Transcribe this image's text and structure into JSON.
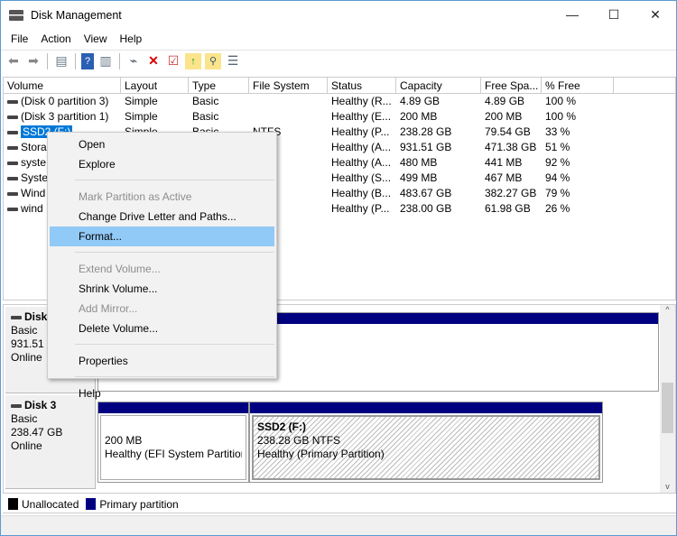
{
  "window": {
    "title": "Disk Management",
    "minimize": "—",
    "maximize": "☐",
    "close": "✕"
  },
  "menu": [
    "File",
    "Action",
    "View",
    "Help"
  ],
  "toolbar": [
    "back-icon",
    "forward-icon",
    "console-tree-icon",
    "help-icon",
    "show-pane-icon",
    "connect-disk-icon",
    "delete-icon",
    "check-icon",
    "folder-up-icon",
    "folder-search-icon",
    "properties-list-icon"
  ],
  "columns": [
    "Volume",
    "Layout",
    "Type",
    "File System",
    "Status",
    "Capacity",
    "Free Spa...",
    "% Free"
  ],
  "rows": [
    [
      "(Disk 0 partition 3)",
      "Simple",
      "Basic",
      "",
      "Healthy (R...",
      "4.89 GB",
      "4.89 GB",
      "100 %"
    ],
    [
      "(Disk 3 partition 1)",
      "Simple",
      "Basic",
      "",
      "Healthy (E...",
      "200 MB",
      "200 MB",
      "100 %"
    ],
    [
      "SSD2 (F:)",
      "Simple",
      "Basic",
      "NTFS",
      "Healthy (P...",
      "238.28 GB",
      "79.54 GB",
      "33 %"
    ],
    [
      "Stora",
      "",
      "",
      "",
      "Healthy (A...",
      "931.51 GB",
      "471.38 GB",
      "51 %"
    ],
    [
      "syste",
      "",
      "",
      "",
      "Healthy (A...",
      "480 MB",
      "441 MB",
      "92 %"
    ],
    [
      "Syste",
      "",
      "",
      "",
      "Healthy (S...",
      "499 MB",
      "467 MB",
      "94 %"
    ],
    [
      "Wind",
      "",
      "",
      "",
      "Healthy (B...",
      "483.67 GB",
      "382.27 GB",
      "79 %"
    ],
    [
      "wind",
      "",
      "",
      "",
      "Healthy (P...",
      "238.00 GB",
      "61.98 GB",
      "26 %"
    ]
  ],
  "disks": [
    {
      "name": "Disk",
      "type": "Basic",
      "size": "931.51 (",
      "state": "Online"
    },
    {
      "name": "Disk 3",
      "type": "Basic",
      "size": "238.47 GB",
      "state": "Online",
      "partitions": [
        {
          "size": "200 MB",
          "status": "Healthy (EFI System Partition"
        },
        {
          "label": "SSD2  (F:)",
          "size": "238.28 GB NTFS",
          "status": "Healthy (Primary Partition)"
        }
      ]
    }
  ],
  "legend": [
    {
      "label": "Unallocated",
      "color": "#000000"
    },
    {
      "label": "Primary partition",
      "color": "#000080"
    }
  ],
  "context_menu": [
    {
      "label": "Open",
      "enabled": true
    },
    {
      "label": "Explore",
      "enabled": true
    },
    {
      "sep": true
    },
    {
      "label": "Mark Partition as Active",
      "enabled": false
    },
    {
      "label": "Change Drive Letter and Paths...",
      "enabled": true
    },
    {
      "label": "Format...",
      "enabled": true,
      "highlighted": true
    },
    {
      "sep": true
    },
    {
      "label": "Extend Volume...",
      "enabled": false
    },
    {
      "label": "Shrink Volume...",
      "enabled": true
    },
    {
      "label": "Add Mirror...",
      "enabled": false
    },
    {
      "label": "Delete Volume...",
      "enabled": true
    },
    {
      "sep": true
    },
    {
      "label": "Properties",
      "enabled": true
    },
    {
      "sep": true
    },
    {
      "label": "Help",
      "enabled": true
    }
  ],
  "colors": {
    "selection": "#0078d7",
    "menu_highlight": "#91c9f7",
    "primary_partition": "#000080"
  }
}
